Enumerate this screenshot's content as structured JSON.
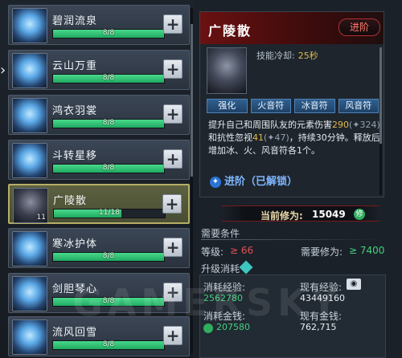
{
  "skills": [
    {
      "name": "碧润流泉",
      "progress": "8/8",
      "fill": 1.0
    },
    {
      "name": "云山万重",
      "progress": "8/8",
      "fill": 1.0
    },
    {
      "name": "鸿衣羽裳",
      "progress": "8/8",
      "fill": 1.0
    },
    {
      "name": "斗转星移",
      "progress": "8/8",
      "fill": 1.0
    },
    {
      "name": "广陵散",
      "progress": "11/18",
      "fill": 0.61,
      "badge": "11"
    },
    {
      "name": "寒冰护体",
      "progress": "8/8",
      "fill": 1.0
    },
    {
      "name": "剑胆琴心",
      "progress": "8/8",
      "fill": 1.0
    },
    {
      "name": "流风回雪",
      "progress": "8/8",
      "fill": 1.0
    }
  ],
  "plus_label": "+",
  "detail": {
    "title": "广陵散",
    "advance_label": "进阶",
    "cooldown_label": "技能冷却:",
    "cooldown_value": "25秒",
    "tags": [
      "强化",
      "火音符",
      "冰音符",
      "风音符"
    ],
    "desc_1": "提升自己和周围队友的元素伤害",
    "desc_v1": "290",
    "desc_v1b": "(✦324)",
    "desc_2": "和抗性忽视",
    "desc_v2": "41",
    "desc_v2b": "(✦47)",
    "desc_3": "，持续30分钟。释放后增加冰、火、风音符各1个。",
    "unlock": "进阶（已解锁）"
  },
  "cultivation": {
    "label": "当前修为:",
    "value": "15049"
  },
  "requirements": {
    "title": "需要条件",
    "level_label": "等级:",
    "level_value": "≥ 66",
    "cult_label": "需要修为:",
    "cult_value": "≥ 7400"
  },
  "upgrade": {
    "title": "升级消耗",
    "exp_cost_label": "消耗经验:",
    "exp_cost_value": "2562780",
    "exp_have_label": "现有经验:",
    "exp_have_value": "43449160",
    "gold_cost_label": "消耗金钱:",
    "gold_cost_value": "207580",
    "gold_have_label": "现有金钱:",
    "gold_have_value": "762,715"
  },
  "watermark": "GAMERSKY",
  "colors": {
    "accent_green": "#44d07d",
    "accent_red": "#e05252",
    "gold": "#e0b94a"
  }
}
